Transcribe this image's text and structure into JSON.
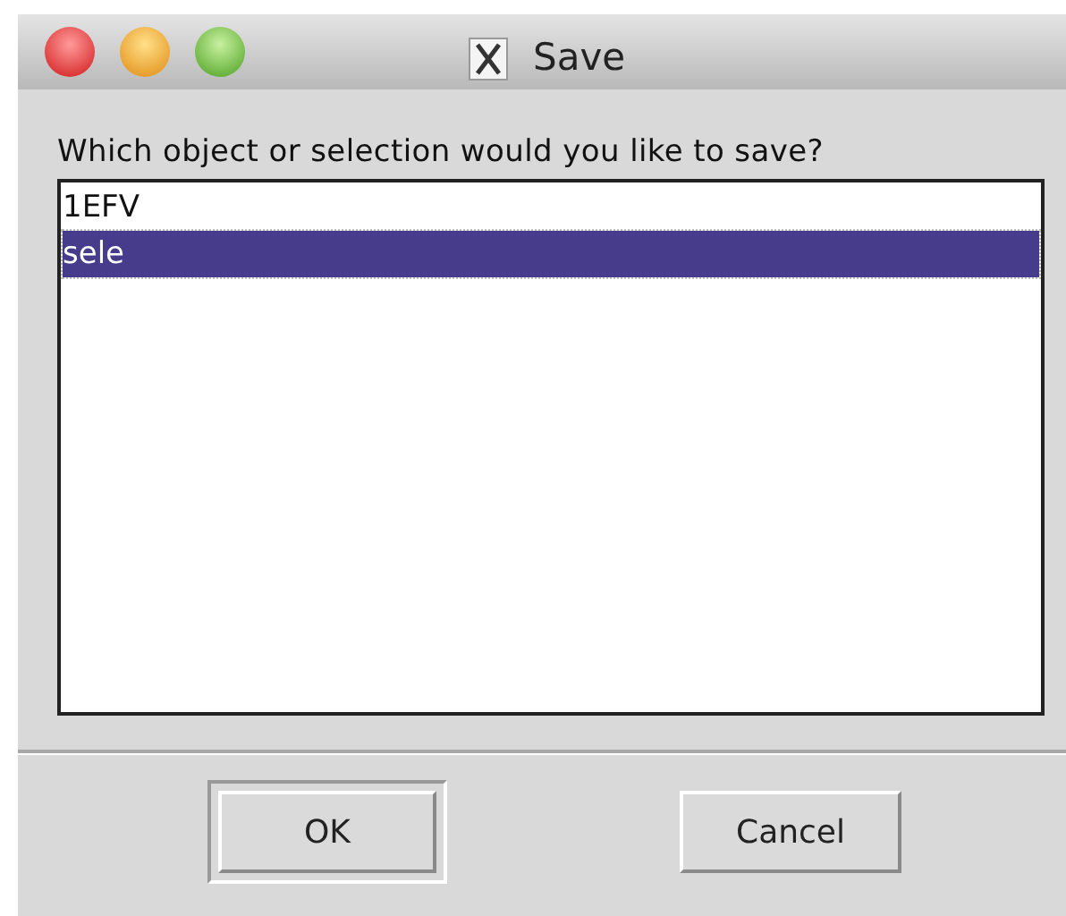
{
  "window": {
    "title": "Save"
  },
  "prompt": "Which object or selection would you like to save?",
  "list": [
    {
      "label": "1EFV",
      "selected": false
    },
    {
      "label": "sele",
      "selected": true
    }
  ],
  "buttons": [
    {
      "label": "OK",
      "default": true
    },
    {
      "label": "Cancel",
      "default": false
    }
  ]
}
